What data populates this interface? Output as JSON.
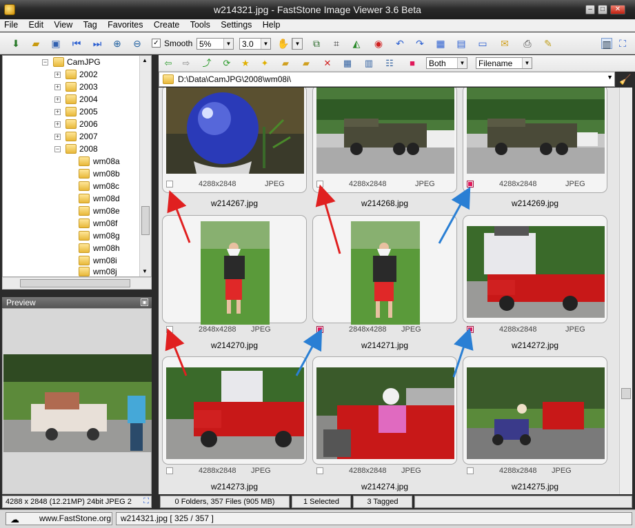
{
  "window": {
    "title": "w214321.jpg  -  FastStone Image Viewer 3.6 Beta"
  },
  "menu": [
    "File",
    "Edit",
    "View",
    "Tag",
    "Favorites",
    "Create",
    "Tools",
    "Settings",
    "Help"
  ],
  "toolbar": {
    "smooth_label": "Smooth",
    "smooth_checked": true,
    "zoom_value": "5%",
    "gamma_value": "3.0"
  },
  "tree": {
    "root": "CamJPG",
    "years": [
      "2002",
      "2003",
      "2004",
      "2005",
      "2006",
      "2007",
      "2008"
    ],
    "subfolders": [
      "wm08a",
      "wm08b",
      "wm08c",
      "wm08d",
      "wm08e",
      "wm08f",
      "wm08g",
      "wm08h",
      "wm08i",
      "wm08j"
    ]
  },
  "preview": {
    "title": "Preview"
  },
  "left_status": "4288 x 2848 (12.21MP)   24bit JPEG   2",
  "browser": {
    "show_mode": "Both",
    "sort_by": "Filename",
    "path": "D:\\Data\\CamJPG\\2008\\wm08i\\"
  },
  "thumbnails": [
    {
      "name": "w214267.jpg",
      "dims": "4288x2848",
      "format": "JPEG",
      "tagged": false
    },
    {
      "name": "w214268.jpg",
      "dims": "4288x2848",
      "format": "JPEG",
      "tagged": false
    },
    {
      "name": "w214269.jpg",
      "dims": "4288x2848",
      "format": "JPEG",
      "tagged": true
    },
    {
      "name": "w214270.jpg",
      "dims": "2848x4288",
      "format": "JPEG",
      "tagged": false
    },
    {
      "name": "w214271.jpg",
      "dims": "2848x4288",
      "format": "JPEG",
      "tagged": true
    },
    {
      "name": "w214272.jpg",
      "dims": "4288x2848",
      "format": "JPEG",
      "tagged": true
    },
    {
      "name": "w214273.jpg",
      "dims": "4288x2848",
      "format": "JPEG",
      "tagged": false
    },
    {
      "name": "w214274.jpg",
      "dims": "4288x2848",
      "format": "JPEG",
      "tagged": false
    },
    {
      "name": "w214275.jpg",
      "dims": "4288x2848",
      "format": "JPEG",
      "tagged": false
    }
  ],
  "status": {
    "files": "0 Folders, 357 Files (905 MB)",
    "selected": "1 Selected",
    "tagged": "3 Tagged"
  },
  "bottom": {
    "website": "www.FastStone.org",
    "current": "w214321.jpg [ 325 / 357 ]"
  },
  "colors": {
    "tag": "#e0185a",
    "red_arrow": "#e02020",
    "blue_arrow": "#2a7fd4"
  }
}
